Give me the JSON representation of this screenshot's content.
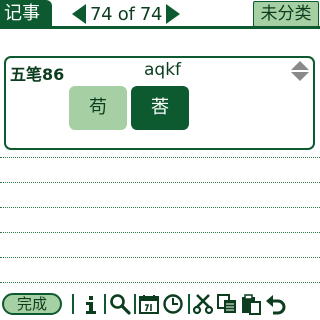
{
  "header": {
    "title": "记事",
    "counter": "74 of 74",
    "category": "未分类"
  },
  "input": {
    "method": "五笔86",
    "code": "aqkf",
    "candidates": [
      "苟",
      "莕"
    ]
  },
  "toolbar": {
    "done_label": "完成",
    "icons": [
      "info-icon",
      "search-icon",
      "calendar-icon",
      "clock-icon",
      "cut-icon",
      "copy-icon",
      "paste-icon",
      "undo-icon"
    ]
  },
  "colors": {
    "primary": "#0d5a30",
    "light": "#a6d0a3"
  }
}
